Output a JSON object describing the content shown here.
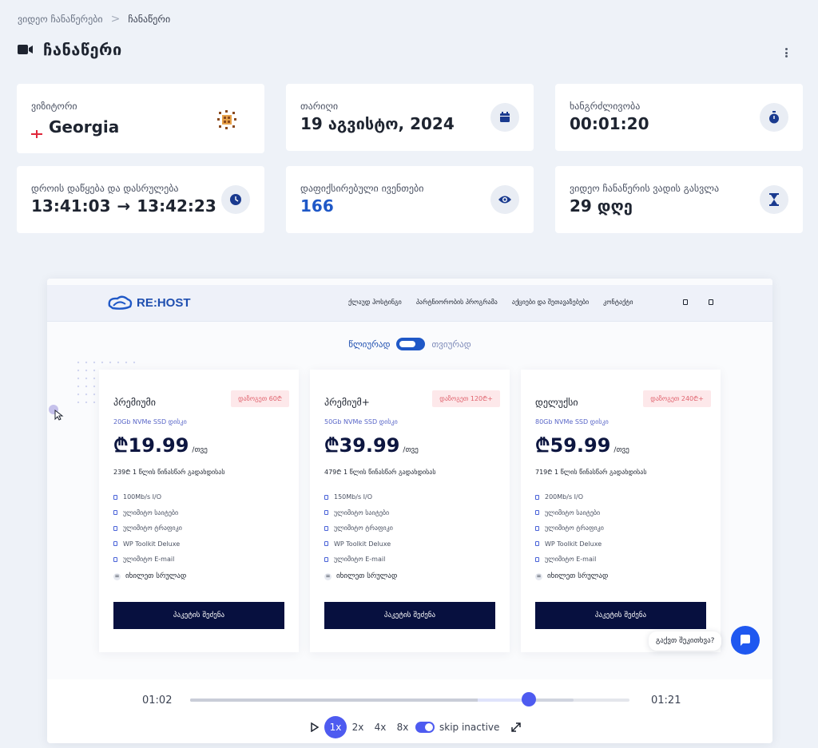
{
  "breadcrumb": {
    "parent": "ვიდეო ჩანაწერები",
    "separator": ">",
    "current": "ჩანაწერი"
  },
  "page": {
    "title": "ჩანაწერი"
  },
  "stats": {
    "visitor": {
      "label": "ვიზიტორი",
      "flag": "🇬🇪",
      "value": "Georgia"
    },
    "date": {
      "label": "თარიღი",
      "value": "19 აგვისტო, 2024"
    },
    "duration": {
      "label": "ხანგრძლივობა",
      "value": "00:01:20"
    },
    "start_end": {
      "label": "დროის დაწყება და დასრულება",
      "start": "13:41:03",
      "arrow": "→",
      "end": "13:42:23"
    },
    "events": {
      "label": "დაფიქსირებული ივენთები",
      "value": "166"
    },
    "expiry": {
      "label": "ვიდეო ჩანაწერის ვადის გასვლა",
      "value": "29 დღე"
    }
  },
  "recording": {
    "logo_text": "RE:HOST",
    "nav_links": [
      "ქლაუდ ჰოსტინგი",
      "პარტნიორობის პროგრამა",
      "აქციები და შეთავაზებები",
      "კონტაქტი"
    ],
    "billing_toggle": {
      "left": "წლიურად",
      "right": "თვიურად"
    },
    "plans": [
      {
        "name": "პრემიუმი",
        "discount": "დაზოგეთ 60₾",
        "disk": "20Gb NVMe SSD დისკი",
        "price": "₾19.99",
        "per": "/თვე",
        "yearly": "239₾ 1 წლის წინასწარ გადახდისას",
        "features": [
          "100Mb/s I/O",
          "ულიმიტო საიტები",
          "ულიმიტო ტრაფიკი",
          "WP Toolkit Deluxe",
          "ულიმიტო E-mail"
        ],
        "more": "იხილეთ სრულად",
        "button": "პაკეტის შეძენა"
      },
      {
        "name": "პრემიუმ+",
        "discount": "დაზოგეთ 120₾+",
        "disk": "50Gb NVMe SSD დისკი",
        "price": "₾39.99",
        "per": "/თვე",
        "yearly": "479₾ 1 წლის წინასწარ გადახდისას",
        "features": [
          "150Mb/s I/O",
          "ულიმიტო საიტები",
          "ულიმიტო ტრაფიკი",
          "WP Toolkit Deluxe",
          "ულიმიტო E-mail"
        ],
        "more": "იხილეთ სრულად",
        "button": "პაკეტის შეძენა"
      },
      {
        "name": "დელუქსი",
        "discount": "დაზოგეთ 240₾+",
        "disk": "80Gb NVMe SSD დისკი",
        "price": "₾59.99",
        "per": "/თვე",
        "yearly": "719₾ 1 წლის წინასწარ გადახდისას",
        "features": [
          "200Mb/s I/O",
          "ულიმიტო საიტები",
          "ულიმიტო ტრაფიკი",
          "WP Toolkit Deluxe",
          "ულიმიტო E-mail"
        ],
        "more": "იხილეთ სრულად",
        "button": "პაკეტის შეძენა"
      }
    ],
    "chat_prompt": "გაქვთ შეკითხვა?"
  },
  "player": {
    "current_time": "01:02",
    "total_time": "01:21",
    "progress": 0.77,
    "speeds": [
      "1x",
      "2x",
      "4x",
      "8x"
    ],
    "active_speed": "1x",
    "skip_inactive_label": "skip inactive",
    "skip_inactive": true
  },
  "colors": {
    "accent": "#4e5bf0",
    "brand_blue": "#1f58c7",
    "dark_button": "#07103f"
  },
  "icons": [
    "video-camera-icon",
    "kebab-menu-icon",
    "georgia-flag-icon",
    "calendar-icon",
    "stopwatch-icon",
    "clock-icon",
    "eye-icon",
    "hourglass-icon",
    "play-icon",
    "fullscreen-icon",
    "chat-icon"
  ]
}
